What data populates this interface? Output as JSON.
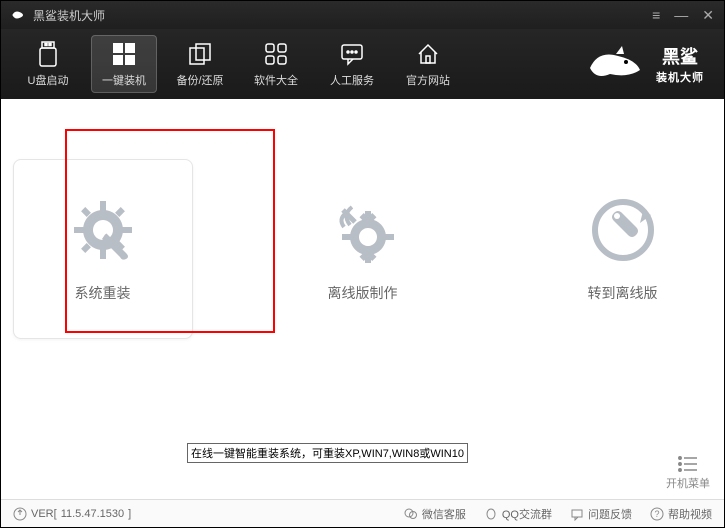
{
  "app": {
    "title": "黑鲨装机大师"
  },
  "toolbar": {
    "items": [
      {
        "label": "U盘启动"
      },
      {
        "label": "一键装机"
      },
      {
        "label": "备份/还原"
      },
      {
        "label": "软件大全"
      },
      {
        "label": "人工服务"
      },
      {
        "label": "官方网站"
      }
    ]
  },
  "logo": {
    "line1": "黑鲨",
    "line2": "装机大师"
  },
  "main": {
    "options": [
      {
        "label": "系统重装",
        "tooltip": "在线一键智能重装系统，可重装XP,WIN7,WIN8或WIN10"
      },
      {
        "label": "离线版制作"
      },
      {
        "label": "转到离线版"
      }
    ]
  },
  "boot_menu": {
    "label": "开机菜单"
  },
  "status": {
    "version_prefix": "VER[",
    "version": "11.5.47.1530",
    "version_suffix": "]",
    "links": [
      {
        "label": "微信客服"
      },
      {
        "label": "QQ交流群"
      },
      {
        "label": "问题反馈"
      },
      {
        "label": "帮助视频"
      }
    ]
  }
}
